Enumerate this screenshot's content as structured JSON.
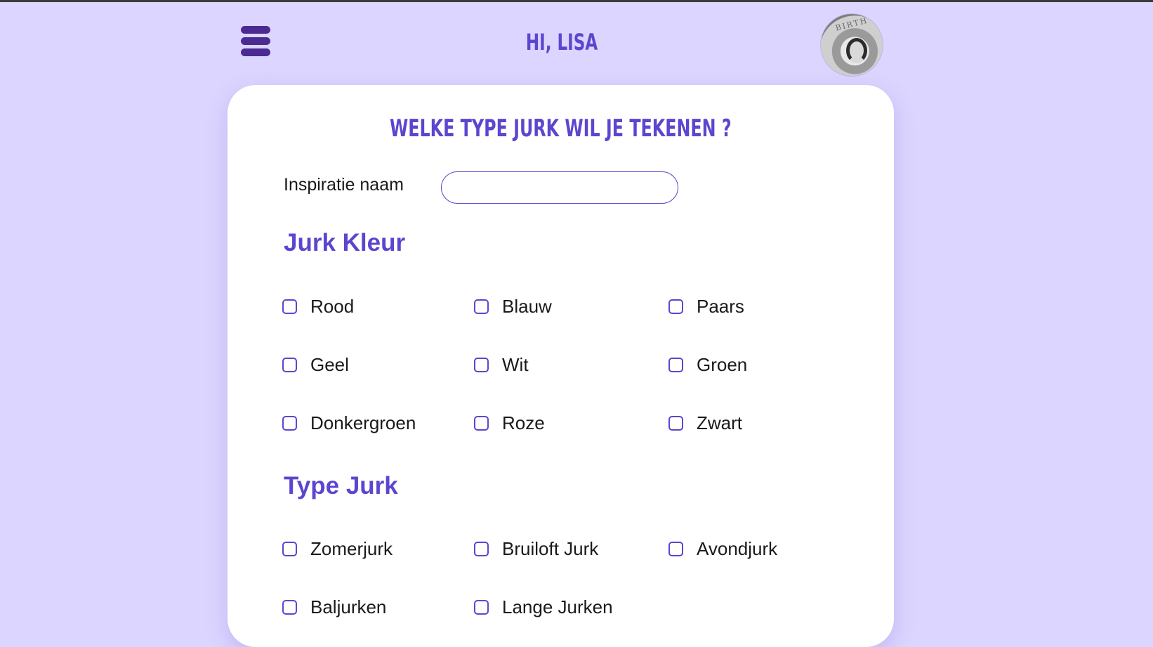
{
  "header": {
    "greeting": "HI, LISA",
    "menu_icon": "hamburger-menu-icon",
    "avatar_banner": "BIRTH"
  },
  "form": {
    "title": "WELKE TYPE JURK WIL JE TEKENEN ?",
    "inspiration_label": "Inspiratie naam",
    "inspiration_value": "",
    "inspiration_placeholder": "",
    "sections": [
      {
        "heading": "Jurk Kleur",
        "options": [
          "Rood",
          "Blauw",
          "Paars",
          "Geel",
          "Wit",
          "Groen",
          "Donkergroen",
          "Roze",
          "Zwart"
        ]
      },
      {
        "heading": "Type Jurk",
        "options": [
          "Zomerjurk",
          "Bruiloft Jurk",
          "Avondjurk",
          "Baljurken",
          "Lange Jurken"
        ]
      }
    ]
  },
  "colors": {
    "background": "#dcd5ff",
    "accent": "#5c46cf",
    "menu": "#4b2a91",
    "card": "#ffffff"
  }
}
